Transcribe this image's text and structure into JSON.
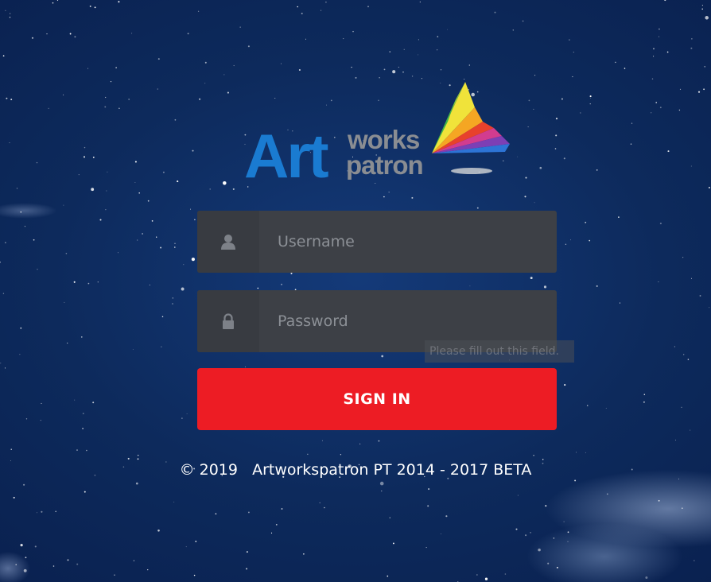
{
  "brand": {
    "logo_text_main": "Art",
    "logo_text_top": "works",
    "logo_text_bottom": "patron"
  },
  "login": {
    "username_placeholder": "Username",
    "password_placeholder": "Password",
    "username_icon": "user-icon",
    "password_icon": "lock-icon",
    "validation_tooltip": "Please fill out this field.",
    "signin_label": "SIGN IN"
  },
  "footer": {
    "text": "© 2019   Artworkspatron PT 2014 - 2017 BETA"
  },
  "colors": {
    "background": "#0d2a5c",
    "field_background": "#3d4046",
    "icon_box_background": "#383b41",
    "signin_button": "#ed1c24",
    "logo_blue": "#1a7bd1",
    "logo_gray": "#8a8d92"
  }
}
